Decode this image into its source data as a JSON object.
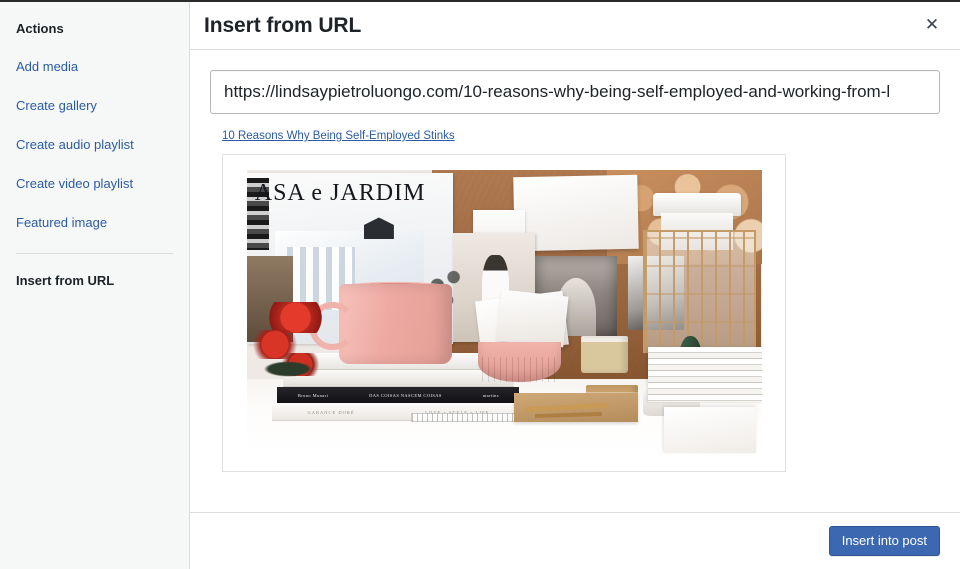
{
  "sidebar": {
    "heading": "Actions",
    "items": [
      {
        "label": "Add media",
        "name": "add-media",
        "active": false
      },
      {
        "label": "Create gallery",
        "name": "create-gallery",
        "active": false
      },
      {
        "label": "Create audio playlist",
        "name": "create-audio-playlist",
        "active": false
      },
      {
        "label": "Create video playlist",
        "name": "create-video-playlist",
        "active": false
      },
      {
        "label": "Featured image",
        "name": "featured-image",
        "active": false
      }
    ],
    "active_item": {
      "label": "Insert from URL",
      "name": "insert-from-url"
    }
  },
  "header": {
    "title": "Insert from URL",
    "close_label": "✕"
  },
  "url_field": {
    "value": "https://lindsaypietroluongo.com/10-reasons-why-being-self-employed-and-working-from-l",
    "placeholder": "https://"
  },
  "embed": {
    "link_text": "10 Reasons Why Being Self-Employed Stinks"
  },
  "preview": {
    "magazine_title": "ASA e JARDIM",
    "black_book_spine_left": "Bruno Munari",
    "black_book_spine_center": "DAS COISAS NASCEM COISAS",
    "black_book_spine_right": "martins",
    "white_book_spine_left": "GARANCE DORÉ",
    "white_book_spine_center": "LOVE × STYLE × LIFE"
  },
  "footer": {
    "insert_label": "Insert into post"
  },
  "colors": {
    "accent_link": "#2b5ba7",
    "primary_button": "#3b68b0",
    "sidebar_bg": "#f6f7f7",
    "border": "#dddddd",
    "text": "#1d2327"
  }
}
